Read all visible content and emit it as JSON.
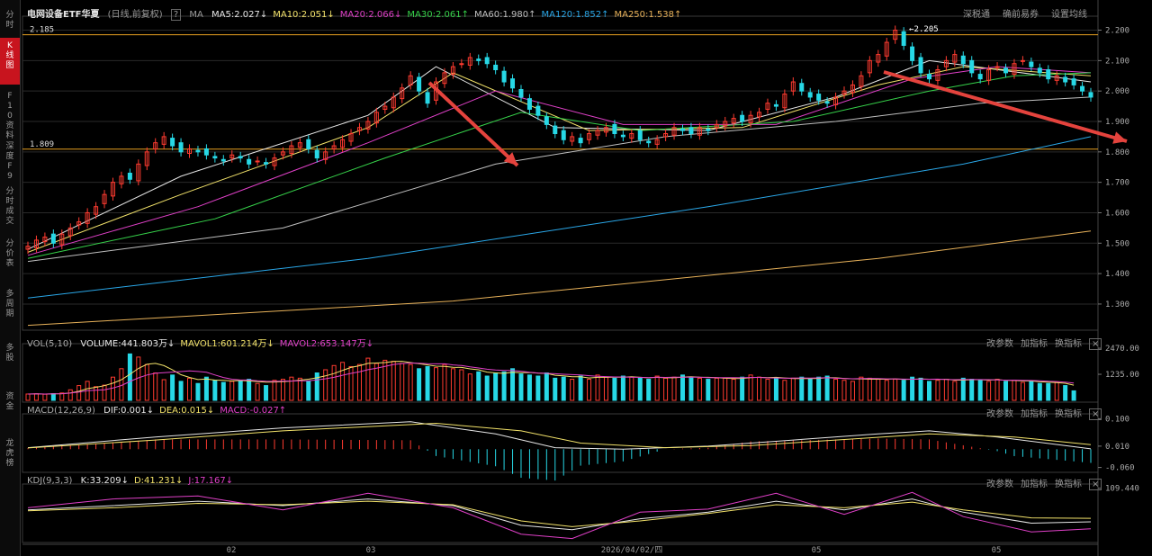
{
  "sidebar": {
    "items": [
      {
        "label": "分时",
        "active": false
      },
      {
        "label": "K线图",
        "active": true
      },
      {
        "label": "F10资料",
        "active": false
      },
      {
        "label": "深度F9",
        "active": false
      },
      {
        "label": "分时成交",
        "active": false
      },
      {
        "label": "分价表",
        "active": false
      },
      {
        "label": "多周期",
        "active": false
      },
      {
        "label": "多股",
        "active": false
      },
      {
        "label": "资金",
        "active": false
      },
      {
        "label": "龙虎榜",
        "active": false
      }
    ]
  },
  "header": {
    "title": "电网设备ETF华夏",
    "period": "(日线,前复权)",
    "help": "?",
    "ma_label": "MA",
    "mas": [
      {
        "text": "MA5:2.027",
        "arrow": "↓",
        "color": "#e6e6e6"
      },
      {
        "text": "MA10:2.051",
        "arrow": "↓",
        "color": "#f2e26a"
      },
      {
        "text": "MA20:2.066",
        "arrow": "↓",
        "color": "#e040c8"
      },
      {
        "text": "MA30:2.061",
        "arrow": "↑",
        "color": "#36d24a"
      },
      {
        "text": "MA60:1.980",
        "arrow": "↑",
        "color": "#bfbfbf"
      },
      {
        "text": "MA120:1.852",
        "arrow": "↑",
        "color": "#2aa7e8"
      },
      {
        "text": "MA250:1.538",
        "arrow": "↑",
        "color": "#e8b25a"
      }
    ],
    "buttons": [
      "深税通",
      "确前易券",
      "设置均线"
    ]
  },
  "panels": {
    "vol": {
      "name": "VOL(5,10)",
      "vals": [
        {
          "text": "VOLUME:441.803万",
          "arrow": "↓",
          "color": "#e6e6e6"
        },
        {
          "text": "MAVOL1:601.214万",
          "arrow": "↓",
          "color": "#f2e26a"
        },
        {
          "text": "MAVOL2:653.147万",
          "arrow": "↓",
          "color": "#e040c8"
        }
      ],
      "buttons": [
        "改参数",
        "加指标",
        "换指标"
      ]
    },
    "macd": {
      "name": "MACD(12,26,9)",
      "vals": [
        {
          "text": "DIF:0.001",
          "arrow": "↓",
          "color": "#e6e6e6"
        },
        {
          "text": "DEA:0.015",
          "arrow": "↓",
          "color": "#f2e26a"
        },
        {
          "text": "MACD:-0.027",
          "arrow": "↑",
          "color": "#e040c8"
        }
      ],
      "buttons": [
        "改参数",
        "加指标",
        "换指标"
      ]
    },
    "kdj": {
      "name": "KDJ(9,3,3)",
      "vals": [
        {
          "text": "K:33.209",
          "arrow": "↓",
          "color": "#e6e6e6"
        },
        {
          "text": "D:41.231",
          "arrow": "↓",
          "color": "#f2e26a"
        },
        {
          "text": "J:17.167",
          "arrow": "↓",
          "color": "#e040c8"
        }
      ],
      "buttons": [
        "改参数",
        "加指标",
        "换指标"
      ]
    }
  },
  "x_axis": {
    "labels": [
      "02",
      "03",
      "2026/04/02/四",
      "05",
      "05"
    ]
  },
  "chart_data": [
    {
      "type": "candlestick",
      "y_ticks": [
        2.2,
        2.1,
        2.0,
        1.9,
        1.8,
        1.7,
        1.6,
        1.5,
        1.4,
        1.3
      ],
      "ylim": [
        1.22,
        2.24
      ],
      "ref_levels": [
        {
          "label": "2.185",
          "value": 2.185,
          "color": "#e8a020"
        },
        {
          "label": "1.809",
          "value": 1.809,
          "color": "#e8a020"
        }
      ],
      "annotation": {
        "label": "←2.205",
        "value": 2.205
      },
      "closes": [
        1.49,
        1.51,
        1.52,
        1.5,
        1.53,
        1.55,
        1.57,
        1.6,
        1.62,
        1.66,
        1.7,
        1.72,
        1.71,
        1.76,
        1.8,
        1.83,
        1.85,
        1.82,
        1.8,
        1.81,
        1.8,
        1.79,
        1.78,
        1.77,
        1.79,
        1.78,
        1.76,
        1.77,
        1.76,
        1.78,
        1.8,
        1.82,
        1.83,
        1.81,
        1.78,
        1.8,
        1.82,
        1.84,
        1.86,
        1.88,
        1.9,
        1.93,
        1.95,
        1.98,
        2.01,
        2.05,
        2.0,
        1.96,
        2.03,
        2.06,
        2.08,
        2.09,
        2.11,
        2.1,
        2.09,
        2.07,
        2.03,
        2.01,
        1.98,
        1.94,
        1.92,
        1.89,
        1.86,
        1.84,
        1.85,
        1.83,
        1.86,
        1.87,
        1.88,
        1.86,
        1.85,
        1.86,
        1.84,
        1.83,
        1.84,
        1.86,
        1.88,
        1.87,
        1.86,
        1.88,
        1.87,
        1.89,
        1.9,
        1.91,
        1.9,
        1.92,
        1.93,
        1.96,
        1.95,
        1.99,
        2.03,
        2.0,
        1.98,
        1.97,
        1.96,
        1.98,
        2.0,
        2.02,
        2.05,
        2.1,
        2.12,
        2.16,
        2.2,
        2.15,
        2.1,
        2.06,
        2.04,
        2.07,
        2.1,
        2.12,
        2.09,
        2.06,
        2.04,
        2.07,
        2.08,
        2.06,
        2.09,
        2.1,
        2.08,
        2.06,
        2.04,
        2.05,
        2.03,
        2.02,
        2.0,
        1.98
      ],
      "ma": [
        {
          "name": "MA5",
          "color": "#e6e6e6",
          "points": [
            [
              0,
              1.48
            ],
            [
              18,
              1.72
            ],
            [
              40,
              1.92
            ],
            [
              48,
              2.08
            ],
            [
              62,
              1.88
            ],
            [
              80,
              1.87
            ],
            [
              95,
              1.98
            ],
            [
              106,
              2.1
            ],
            [
              125,
              2.03
            ]
          ]
        },
        {
          "name": "MA10",
          "color": "#f2e26a",
          "points": [
            [
              0,
              1.47
            ],
            [
              18,
              1.66
            ],
            [
              40,
              1.88
            ],
            [
              50,
              2.06
            ],
            [
              66,
              1.87
            ],
            [
              84,
              1.88
            ],
            [
              100,
              2.02
            ],
            [
              110,
              2.08
            ],
            [
              125,
              2.05
            ]
          ]
        },
        {
          "name": "MA20",
          "color": "#e040c8",
          "points": [
            [
              0,
              1.46
            ],
            [
              20,
              1.62
            ],
            [
              40,
              1.83
            ],
            [
              55,
              2.0
            ],
            [
              70,
              1.89
            ],
            [
              88,
              1.89
            ],
            [
              104,
              2.04
            ],
            [
              114,
              2.08
            ],
            [
              125,
              2.06
            ]
          ]
        },
        {
          "name": "MA30",
          "color": "#36d24a",
          "points": [
            [
              0,
              1.45
            ],
            [
              22,
              1.58
            ],
            [
              42,
              1.78
            ],
            [
              58,
              1.93
            ],
            [
              72,
              1.87
            ],
            [
              90,
              1.9
            ],
            [
              106,
              2.0
            ],
            [
              116,
              2.05
            ],
            [
              125,
              2.06
            ]
          ]
        },
        {
          "name": "MA60",
          "color": "#bfbfbf",
          "points": [
            [
              0,
              1.44
            ],
            [
              30,
              1.55
            ],
            [
              55,
              1.76
            ],
            [
              75,
              1.85
            ],
            [
              95,
              1.9
            ],
            [
              112,
              1.96
            ],
            [
              125,
              1.98
            ]
          ]
        },
        {
          "name": "MA120",
          "color": "#2aa7e8",
          "points": [
            [
              0,
              1.32
            ],
            [
              40,
              1.45
            ],
            [
              80,
              1.62
            ],
            [
              110,
              1.76
            ],
            [
              125,
              1.85
            ]
          ]
        },
        {
          "name": "MA250",
          "color": "#e8b25a",
          "points": [
            [
              0,
              1.23
            ],
            [
              50,
              1.31
            ],
            [
              100,
              1.45
            ],
            [
              125,
              1.54
            ]
          ]
        }
      ]
    },
    {
      "type": "bar",
      "title": "VOL",
      "y_ticks": [
        2470.0,
        1235.0
      ],
      "ylim": [
        0,
        2600
      ],
      "values": [
        300,
        310,
        290,
        320,
        350,
        500,
        700,
        900,
        650,
        720,
        1100,
        1500,
        2200,
        2050,
        1700,
        1300,
        980,
        1200,
        900,
        1050,
        800,
        1100,
        950,
        850,
        900,
        900,
        1000,
        800,
        700,
        950,
        1000,
        1100,
        1050,
        900,
        1300,
        1450,
        1650,
        1800,
        1600,
        1700,
        2000,
        1750,
        1900,
        1850,
        1750,
        1700,
        1500,
        1600,
        1550,
        1700,
        1500,
        1450,
        1250,
        1350,
        1150,
        1300,
        1350,
        1500,
        1250,
        1200,
        1150,
        1300,
        1050,
        1100,
        1000,
        1150,
        1000,
        1200,
        1100,
        1050,
        1150,
        1100,
        1050,
        1000,
        1150,
        1050,
        1100,
        1200,
        1100,
        1050,
        1000,
        1050,
        1050,
        1000,
        1100,
        1200,
        1100,
        1000,
        1050,
        950,
        1050,
        1100,
        1000,
        1100,
        1150,
        1000,
        950,
        900,
        1100,
        1050,
        1000,
        950,
        1000,
        950,
        1100,
        1050,
        900,
        950,
        1000,
        900,
        1050,
        1000,
        950,
        900,
        1000,
        900,
        950,
        850,
        900,
        800,
        800,
        850,
        700,
        450
      ]
    },
    {
      "type": "line",
      "title": "MACD",
      "y_ticks": [
        0.1,
        0.01,
        -0.06
      ],
      "ylim": [
        -0.07,
        0.11
      ],
      "series": [
        {
          "name": "DIF",
          "color": "#e6e6e6",
          "points": [
            [
              0,
              0.005
            ],
            [
              15,
              0.04
            ],
            [
              30,
              0.07
            ],
            [
              45,
              0.09
            ],
            [
              55,
              0.05
            ],
            [
              62,
              0.005
            ],
            [
              70,
              0.0
            ],
            [
              80,
              0.01
            ],
            [
              90,
              0.03
            ],
            [
              100,
              0.05
            ],
            [
              106,
              0.06
            ],
            [
              114,
              0.04
            ],
            [
              125,
              0.001
            ]
          ]
        },
        {
          "name": "DEA",
          "color": "#f2e26a",
          "points": [
            [
              0,
              0.004
            ],
            [
              15,
              0.03
            ],
            [
              30,
              0.06
            ],
            [
              48,
              0.085
            ],
            [
              58,
              0.06
            ],
            [
              65,
              0.02
            ],
            [
              75,
              0.005
            ],
            [
              85,
              0.012
            ],
            [
              95,
              0.03
            ],
            [
              106,
              0.05
            ],
            [
              116,
              0.04
            ],
            [
              125,
              0.015
            ]
          ]
        }
      ]
    },
    {
      "type": "line",
      "title": "KDJ",
      "y_ticks": [
        109.44
      ],
      "ylim": [
        -10,
        115
      ],
      "series": [
        {
          "name": "K",
          "color": "#e6e6e6",
          "points": [
            [
              0,
              60
            ],
            [
              10,
              70
            ],
            [
              20,
              80
            ],
            [
              30,
              70
            ],
            [
              40,
              85
            ],
            [
              50,
              70
            ],
            [
              58,
              25
            ],
            [
              64,
              15
            ],
            [
              72,
              40
            ],
            [
              80,
              55
            ],
            [
              88,
              80
            ],
            [
              96,
              60
            ],
            [
              104,
              85
            ],
            [
              110,
              55
            ],
            [
              118,
              30
            ],
            [
              125,
              33
            ]
          ]
        },
        {
          "name": "D",
          "color": "#f2e26a",
          "points": [
            [
              0,
              58
            ],
            [
              10,
              65
            ],
            [
              20,
              75
            ],
            [
              30,
              72
            ],
            [
              40,
              80
            ],
            [
              50,
              72
            ],
            [
              58,
              35
            ],
            [
              64,
              22
            ],
            [
              72,
              35
            ],
            [
              80,
              52
            ],
            [
              88,
              72
            ],
            [
              96,
              65
            ],
            [
              104,
              78
            ],
            [
              110,
              60
            ],
            [
              118,
              42
            ],
            [
              125,
              41
            ]
          ]
        },
        {
          "name": "J",
          "color": "#e040c8",
          "points": [
            [
              0,
              65
            ],
            [
              10,
              85
            ],
            [
              20,
              92
            ],
            [
              30,
              60
            ],
            [
              40,
              98
            ],
            [
              50,
              65
            ],
            [
              58,
              5
            ],
            [
              64,
              -5
            ],
            [
              72,
              55
            ],
            [
              80,
              62
            ],
            [
              88,
              98
            ],
            [
              96,
              50
            ],
            [
              104,
              100
            ],
            [
              110,
              45
            ],
            [
              118,
              10
            ],
            [
              125,
              17
            ]
          ]
        }
      ]
    }
  ],
  "colors": {
    "up": "#ff3b30",
    "down": "#27d8e6",
    "grid": "#2a2a2a",
    "panel_border": "#3a3a3a",
    "bg": "#000000"
  }
}
